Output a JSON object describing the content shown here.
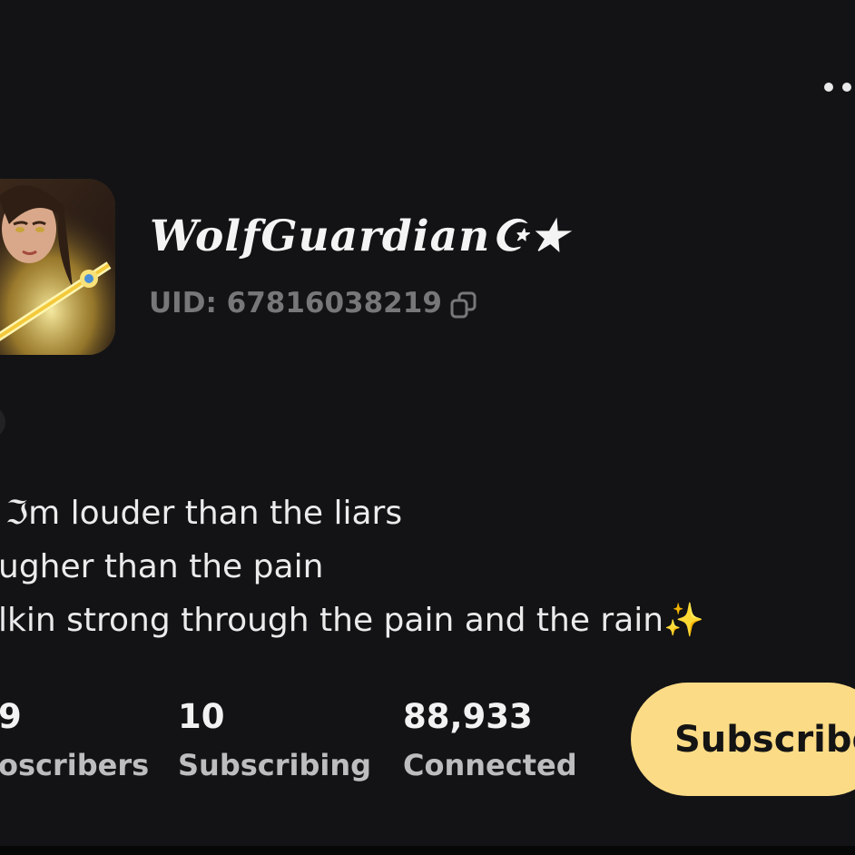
{
  "header": {
    "menu_icon": "more-dots-icon"
  },
  "profile": {
    "username": "WolfGuardian☪︎★",
    "uid": "UID: 67816038219",
    "copy_icon": "copy-icon"
  },
  "bio": {
    "lines": [
      "ℑm louder than the liars",
      "ugher than the pain",
      "lkin strong through the pain and the rain✨"
    ]
  },
  "stats": [
    {
      "value": "9",
      "label": "oscribers"
    },
    {
      "value": "10",
      "label": "Subscribing"
    },
    {
      "value": "88,933",
      "label": "Connected"
    }
  ],
  "actions": {
    "subscribe_label": "Subscribe"
  },
  "colors": {
    "background": "#131315",
    "accent": "#fcdb86",
    "muted_text": "#777779",
    "label_text": "#bdbdbf"
  }
}
